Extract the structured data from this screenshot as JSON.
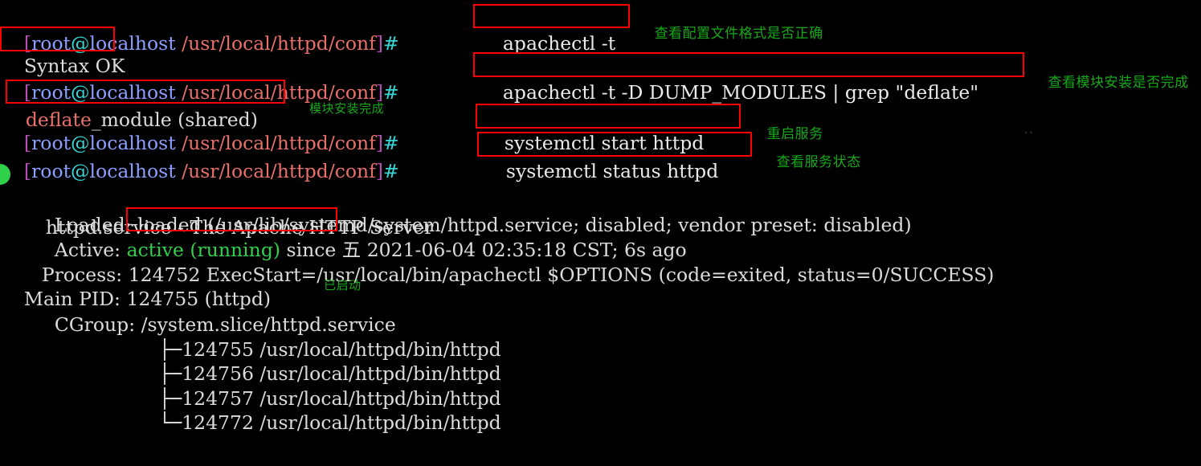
{
  "terminal": {
    "prompt": {
      "open_bracket": "[",
      "user": "root",
      "at": "@",
      "host": "localhost",
      "space": " ",
      "path": "/usr/local/httpd/conf",
      "close_bracket": "]",
      "hash": "#"
    },
    "colors": {
      "background": "#000000",
      "foreground": "#dcdcdc",
      "bracket": "#b54fb5",
      "user_host": "#8c9eff",
      "at_hash": "#37d6d6",
      "path": "#e8706a",
      "grep_match": "#e8706a",
      "green_status": "#2fd14b",
      "annotation_green": "#17a81a",
      "highlight_box": "#ff0000"
    },
    "lines": [
      {
        "type": "prompt",
        "command": "apachectl -t",
        "annotation": "查看配置文件格式是否正确"
      },
      {
        "type": "output",
        "text": "Syntax OK"
      },
      {
        "type": "prompt",
        "command": "apachectl -t -D DUMP_MODULES | grep \"deflate\"",
        "annotation": "查看模块安装是否完成"
      },
      {
        "type": "output",
        "match": "deflate",
        "rest": "_module (shared)",
        "annotation": "模块安装完成"
      },
      {
        "type": "prompt",
        "command": "systemctl start httpd",
        "annotation": "重启服务"
      },
      {
        "type": "prompt",
        "command": "systemctl status httpd",
        "annotation": "查看服务状态"
      }
    ],
    "status": {
      "unit_title": "httpd.service - The Apache HTTP Server",
      "loaded_label": "Loaded:",
      "loaded_value": "loaded (/usr/lib/systemd/system/httpd.service; disabled; vendor preset: disabled)",
      "active_label": "Active:",
      "active_state": "active (running)",
      "active_rest": " since 五 2021-06-04 02:35:18 CST; 6s ago",
      "process_label": "Process:",
      "process_value": "124752 ExecStart=/usr/local/bin/apachectl $OPTIONS (code=exited, status=0/SUCCESS)",
      "mainpid_label": "Main PID:",
      "mainpid_value": "124755 (httpd)",
      "mainpid_annotation": "已启动",
      "cgroup_label": "CGroup:",
      "cgroup_value": "/system.slice/httpd.service",
      "cgroup_children": [
        {
          "branch": "├─",
          "pid": "124755",
          "cmd": "/usr/local/httpd/bin/httpd"
        },
        {
          "branch": "├─",
          "pid": "124756",
          "cmd": "/usr/local/httpd/bin/httpd"
        },
        {
          "branch": "├─",
          "pid": "124757",
          "cmd": "/usr/local/httpd/bin/httpd"
        },
        {
          "branch": "└─",
          "pid": "124772",
          "cmd": "/usr/local/httpd/bin/httpd"
        }
      ]
    }
  }
}
